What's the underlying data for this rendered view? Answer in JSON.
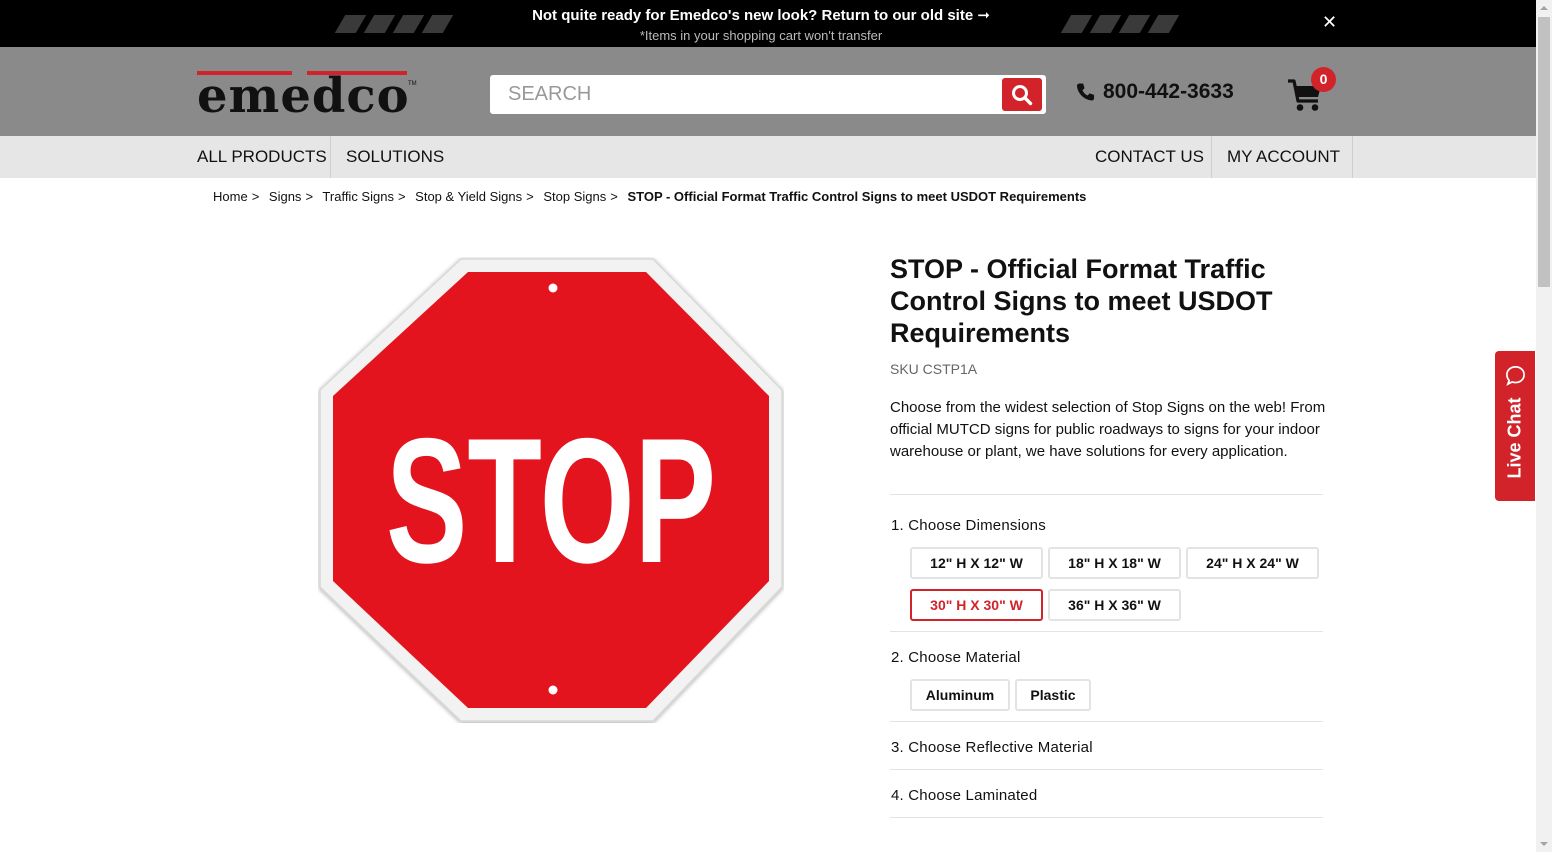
{
  "banner": {
    "message": "Not quite ready for Emedco's new look? Return to our old site ➞",
    "subtext": "*Items in your shopping cart won't transfer",
    "close_glyph": "✕"
  },
  "header": {
    "logo_text": "emedco",
    "logo_tm": "TM",
    "search_placeholder": "SEARCH",
    "phone": "800-442-3633",
    "cart_count": "0",
    "accent_color": "#d2232a"
  },
  "nav": {
    "all_products": "All Products",
    "solutions": "Solutions",
    "contact_us": "Contact Us",
    "my_account": "My Account"
  },
  "breadcrumb": {
    "items": [
      "Home",
      "Signs",
      "Traffic Signs",
      "Stop & Yield Signs",
      "Stop Signs"
    ],
    "separator": ">",
    "current": "STOP - Official Format Traffic Control Signs to meet USDOT Requirements"
  },
  "product": {
    "image_text": "STOP",
    "title": "STOP - Official Format Traffic Control Signs to meet USDOT Requirements",
    "sku": "SKU CSTP1A",
    "description": "Choose from the widest selection of Stop Signs on the web! From official MUTCD signs for public roadways to signs for your indoor warehouse or plant, we have solutions for every application.",
    "steps": {
      "dimensions": "1. Choose Dimensions",
      "material": "2. Choose Material",
      "reflective": "3. Choose Reflective Material",
      "laminated": "4. Choose Laminated"
    },
    "dimensions": [
      "12\" H X 12\" W",
      "18\" H X 18\" W",
      "24\" H X 24\" W",
      "30\" H X 30\" W",
      "36\" H X 36\" W"
    ],
    "selected_dimension": "30\" H X 30\" W",
    "materials": [
      "Aluminum",
      "Plastic"
    ]
  },
  "live_chat": {
    "label": "Live Chat"
  },
  "icons": [
    "close-icon",
    "search-icon",
    "phone-icon",
    "cart-icon",
    "chat-bubble-icon"
  ]
}
